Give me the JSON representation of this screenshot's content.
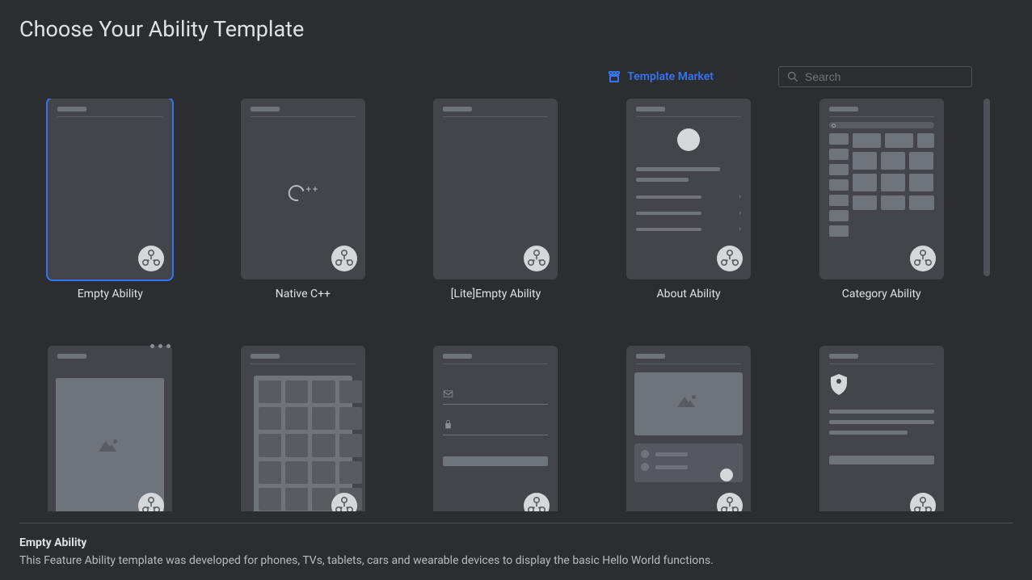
{
  "title": "Choose Your Ability Template",
  "market_link": "Template Market",
  "search": {
    "placeholder": "Search"
  },
  "templates": [
    {
      "name": "Empty Ability"
    },
    {
      "name": "Native C++"
    },
    {
      "name": "[Lite]Empty Ability"
    },
    {
      "name": "About Ability"
    },
    {
      "name": "Category Ability"
    }
  ],
  "selected": {
    "title": "Empty Ability",
    "description": "This Feature Ability template was developed for phones, TVs, tablets, cars and wearable devices to display the basic Hello World functions."
  }
}
